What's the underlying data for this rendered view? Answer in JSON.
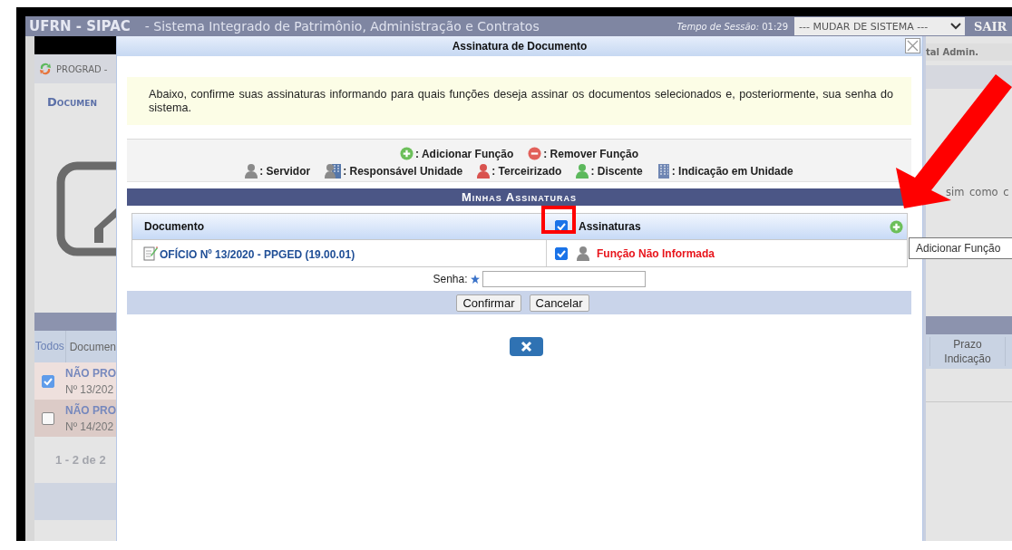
{
  "header": {
    "logo": "UFRN - SIPAC",
    "subtitle": "- Sistema Integrado de Patrimônio, Administração e Contratos",
    "session_label": "Tempo de Sessão:",
    "session_time": "01:29",
    "system_select": "--- MUDAR DE SISTEMA ---",
    "logout": "SAIR"
  },
  "page_left": {
    "unit": "PROGRAD -",
    "section_title": "Documen",
    "table": {
      "columns": [
        "Todos",
        "Documen"
      ],
      "rows": [
        {
          "checked": true,
          "title": "NÃO PRO",
          "number": "Nº 13/202"
        },
        {
          "checked": false,
          "title": "NÃO PRO",
          "number": "Nº 14/202"
        }
      ],
      "pagination": "1 - 2 de 2"
    }
  },
  "page_right": {
    "portal_link": "tal Admin.",
    "text": "sim como c",
    "column": "Prazo Indicação"
  },
  "dialog": {
    "title": "Assinatura de Documento",
    "notice": "Abaixo, confirme suas assinaturas informando para quais funções deseja assinar os documentos selecionados e, posteriormente, sua senha do sistema.",
    "legend_actions": [
      {
        "kind": "add",
        "label": ": Adicionar Função"
      },
      {
        "kind": "remove",
        "label": ": Remover Função"
      }
    ],
    "legend_roles": [
      {
        "kind": "servidor",
        "label": ": Servidor"
      },
      {
        "kind": "responsavel",
        "label": ": Responsável Unidade"
      },
      {
        "kind": "terceirizado",
        "label": ": Terceirizado"
      },
      {
        "kind": "discente",
        "label": ": Discente"
      },
      {
        "kind": "unidade",
        "label": ": Indicação em Unidade"
      }
    ],
    "section_title": "Minhas Assinaturas",
    "columns": [
      "Documento",
      "Assinaturas"
    ],
    "all_checked": true,
    "rows": [
      {
        "document": "OFÍCIO Nº 13/2020 - PPGED (19.00.01)",
        "checked": true,
        "kind": "servidor",
        "function": "Função Não Informada"
      }
    ],
    "password_label": "Senha:",
    "buttons": [
      "Confirmar",
      "Cancelar"
    ]
  },
  "tooltip": "Adicionar Função"
}
